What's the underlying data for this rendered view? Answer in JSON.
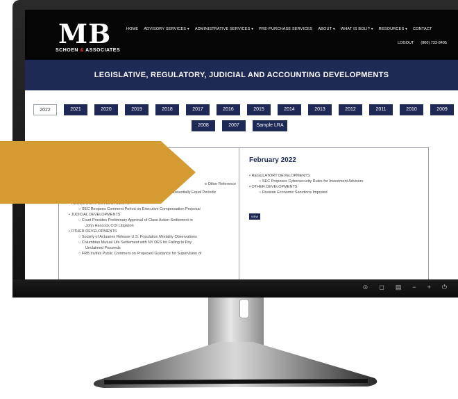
{
  "header": {
    "logo_mark": "MB",
    "logo_sub_left": "SCHOEN",
    "logo_sub_amp": "&",
    "logo_sub_right": "ASSOCIATES",
    "nav": [
      "HOME",
      "ADVISORY SERVICES  ▾",
      "ADMINISTRATIVE SERVICES  ▾",
      "PRE-PURCHASE SERVICES",
      "ABOUT  ▾",
      "WHAT IS BOLI?  ▾",
      "RESOURCES  ▾",
      "CONTACT"
    ],
    "subnav": [
      "LOGOUT",
      "(800) 733-8405"
    ]
  },
  "banner": {
    "title": "LEGISLATIVE, REGULATORY, JUDICIAL AND ACCOUNTING DEVELOPMENTS"
  },
  "years": {
    "row1": [
      "2022",
      "2021",
      "2020",
      "2019",
      "2018",
      "2017",
      "2016",
      "2015",
      "2014",
      "2013",
      "2012",
      "2011",
      "2010",
      "2009"
    ],
    "row2": [
      "2008",
      "2007",
      "Sample LRA"
    ],
    "active": "2022"
  },
  "left_panel": {
    "visible_lines": [
      {
        "level": 3,
        "text": "e Other Reference"
      },
      {
        "level": 3,
        "text": "ubstantially Equal Periodic"
      },
      {
        "level": 3,
        "text": "ayments"
      },
      {
        "level": 1,
        "text": "REGULATORY DEVELOPMENTS"
      },
      {
        "level": 2,
        "text": "SEC Reopens Comment Period on Executive Compensation Proposal"
      },
      {
        "level": 1,
        "text": "JUDICIAL DEVELOPMENTS"
      },
      {
        "level": 2,
        "text": "Court Provides Preliminary Approval of Class Action Settlement in"
      },
      {
        "level": 3,
        "text": "John Hancock COI Litigation"
      },
      {
        "level": 1,
        "text": "OTHER DEVELOPMENTS"
      },
      {
        "level": 2,
        "text": "Society of Actuaries Release U.S. Population Mortality Observations"
      },
      {
        "level": 2,
        "text": "Columbian Mutual Life Settlement with NY DFS for Failing to Pay"
      },
      {
        "level": 3,
        "text": "Unclaimed Proceeds"
      },
      {
        "level": 2,
        "text": "FRB Invites Public Comment on Proposed Guidance for Supervision of"
      }
    ]
  },
  "right_panel": {
    "title": "February 2022",
    "lines": [
      {
        "level": 1,
        "text": "REGULATORY DEVELOPMENTS"
      },
      {
        "level": 2,
        "text": "SEC Proposes Cybersecurity Rules for Investment Advisors"
      },
      {
        "level": 1,
        "text": "OTHER DEVELOPMENTS"
      },
      {
        "level": 2,
        "text": "Russian Economic Sanctions Imposed"
      }
    ],
    "view_label": "VIEW"
  },
  "monitor_controls": [
    "⊙",
    "◻",
    "▤",
    "−",
    "+",
    "⏻"
  ],
  "colors": {
    "navy": "#1e2a55",
    "arrow": "#d49b33",
    "logo_accent": "#e04848"
  }
}
